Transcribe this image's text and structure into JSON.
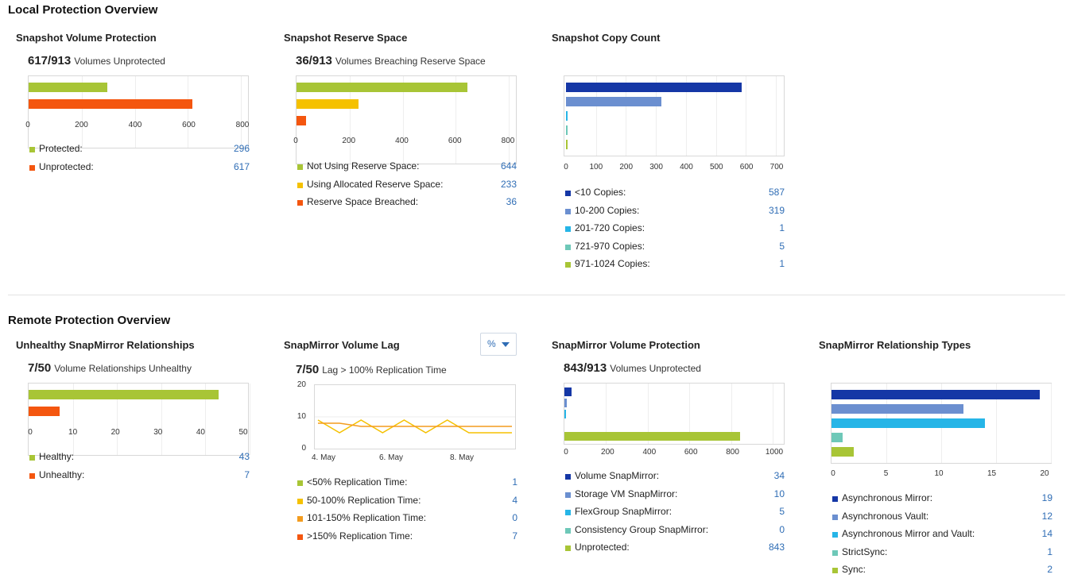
{
  "sections": {
    "local_title": "Local Protection Overview",
    "remote_title": "Remote Protection Overview"
  },
  "colors": {
    "green": "#a8c536",
    "orange": "#f4560f",
    "yellow": "#f5c100",
    "navy": "#1537a6",
    "steel": "#6b8fd0",
    "sky": "#26b5e7",
    "teal": "#6ec8b8",
    "amber": "#f39c1f",
    "link": "#2f6db5"
  },
  "cards": {
    "snapshot_volume_protection": {
      "title": "Snapshot Volume Protection",
      "big": "617/913",
      "small": "Volumes Unprotected",
      "ticks": [
        "0",
        "200",
        "400",
        "600",
        "800"
      ],
      "xmax": 800,
      "legend": [
        {
          "label": "Protected:",
          "value": "296"
        },
        {
          "label": "Unprotected:",
          "value": "617"
        }
      ]
    },
    "snapshot_reserve_space": {
      "title": "Snapshot Reserve Space",
      "big": "36/913",
      "small": "Volumes Breaching Reserve Space",
      "ticks": [
        "0",
        "200",
        "400",
        "600",
        "800"
      ],
      "xmax": 800,
      "legend": [
        {
          "label": "Not Using Reserve Space:",
          "value": "644"
        },
        {
          "label": "Using Allocated Reserve Space:",
          "value": "233"
        },
        {
          "label": "Reserve Space Breached:",
          "value": "36"
        }
      ]
    },
    "snapshot_copy_count": {
      "title": "Snapshot Copy Count",
      "ticks": [
        "0",
        "100",
        "200",
        "300",
        "400",
        "500",
        "600",
        "700"
      ],
      "xmax": 700,
      "legend": [
        {
          "label": "<10 Copies:",
          "value": "587"
        },
        {
          "label": "10-200 Copies:",
          "value": "319"
        },
        {
          "label": "201-720 Copies:",
          "value": "1"
        },
        {
          "label": "721-970 Copies:",
          "value": "5"
        },
        {
          "label": "971-1024 Copies:",
          "value": "1"
        }
      ]
    },
    "unhealthy_snapmirror": {
      "title": "Unhealthy SnapMirror Relationships",
      "big": "7/50",
      "small": "Volume Relationships Unhealthy",
      "ticks": [
        "0",
        "10",
        "20",
        "30",
        "40",
        "50"
      ],
      "xmax": 50,
      "legend": [
        {
          "label": "Healthy:",
          "value": "43"
        },
        {
          "label": "Unhealthy:",
          "value": "7"
        }
      ]
    },
    "snapmirror_volume_lag": {
      "title": "SnapMirror Volume Lag",
      "dropdown": "%",
      "big": "7/50",
      "small": "Lag > 100% Replication Time",
      "yticks": [
        "20",
        "10",
        "0"
      ],
      "xticks": [
        "4. May",
        "6. May",
        "8. May"
      ],
      "legend": [
        {
          "label": "<50% Replication Time:",
          "value": "1"
        },
        {
          "label": "50-100% Replication Time:",
          "value": "4"
        },
        {
          "label": "101-150% Replication Time:",
          "value": "0"
        },
        {
          "label": ">150% Replication Time:",
          "value": "7"
        }
      ]
    },
    "snapmirror_volume_protection": {
      "title": "SnapMirror Volume Protection",
      "big": "843/913",
      "small": "Volumes Unprotected",
      "ticks": [
        "0",
        "200",
        "400",
        "600",
        "800",
        "1000"
      ],
      "xmax": 1000,
      "legend": [
        {
          "label": "Volume SnapMirror:",
          "value": "34"
        },
        {
          "label": "Storage VM SnapMirror:",
          "value": "10"
        },
        {
          "label": "FlexGroup SnapMirror:",
          "value": "5"
        },
        {
          "label": "Consistency Group SnapMirror:",
          "value": "0"
        },
        {
          "label": "Unprotected:",
          "value": "843"
        }
      ]
    },
    "snapmirror_relationship_types": {
      "title": "SnapMirror Relationship Types",
      "ticks": [
        "0",
        "5",
        "10",
        "15",
        "20"
      ],
      "xmax": 20,
      "legend": [
        {
          "label": "Asynchronous Mirror:",
          "value": "19"
        },
        {
          "label": "Asynchronous Vault:",
          "value": "12"
        },
        {
          "label": "Asynchronous Mirror and Vault:",
          "value": "14"
        },
        {
          "label": "StrictSync:",
          "value": "1"
        },
        {
          "label": "Sync:",
          "value": "2"
        }
      ]
    }
  },
  "chart_data": [
    {
      "type": "bar",
      "title": "Snapshot Volume Protection",
      "categories": [
        "Protected",
        "Unprotected"
      ],
      "values": [
        296,
        617
      ],
      "xlim": [
        0,
        800
      ]
    },
    {
      "type": "bar",
      "title": "Snapshot Reserve Space",
      "categories": [
        "Not Using Reserve Space",
        "Using Allocated Reserve Space",
        "Reserve Space Breached"
      ],
      "values": [
        644,
        233,
        36
      ],
      "xlim": [
        0,
        800
      ]
    },
    {
      "type": "bar",
      "title": "Snapshot Copy Count",
      "categories": [
        "<10 Copies",
        "10-200 Copies",
        "201-720 Copies",
        "721-970 Copies",
        "971-1024 Copies"
      ],
      "values": [
        587,
        319,
        1,
        5,
        1
      ],
      "xlim": [
        0,
        700
      ]
    },
    {
      "type": "bar",
      "title": "Unhealthy SnapMirror Relationships",
      "categories": [
        "Healthy",
        "Unhealthy"
      ],
      "values": [
        43,
        7
      ],
      "xlim": [
        0,
        50
      ]
    },
    {
      "type": "line",
      "title": "SnapMirror Volume Lag",
      "ylim": [
        0,
        20
      ],
      "x": [
        "4. May",
        "6. May",
        "8. May"
      ],
      "series": [
        {
          "name": "50-100% Replication Time",
          "values": [
            9,
            5,
            9,
            5,
            9,
            5,
            9,
            5,
            5,
            5
          ]
        },
        {
          "name": ">150% Replication Time",
          "values": [
            8,
            8,
            7,
            7,
            7,
            7,
            7,
            7,
            7,
            7
          ]
        }
      ]
    },
    {
      "type": "bar",
      "title": "SnapMirror Volume Protection",
      "categories": [
        "Volume SnapMirror",
        "Storage VM SnapMirror",
        "FlexGroup SnapMirror",
        "Consistency Group SnapMirror",
        "Unprotected"
      ],
      "values": [
        34,
        10,
        5,
        0,
        843
      ],
      "xlim": [
        0,
        1000
      ]
    },
    {
      "type": "bar",
      "title": "SnapMirror Relationship Types",
      "categories": [
        "Asynchronous Mirror",
        "Asynchronous Vault",
        "Asynchronous Mirror and Vault",
        "StrictSync",
        "Sync"
      ],
      "values": [
        19,
        12,
        14,
        1,
        2
      ],
      "xlim": [
        0,
        20
      ]
    }
  ]
}
